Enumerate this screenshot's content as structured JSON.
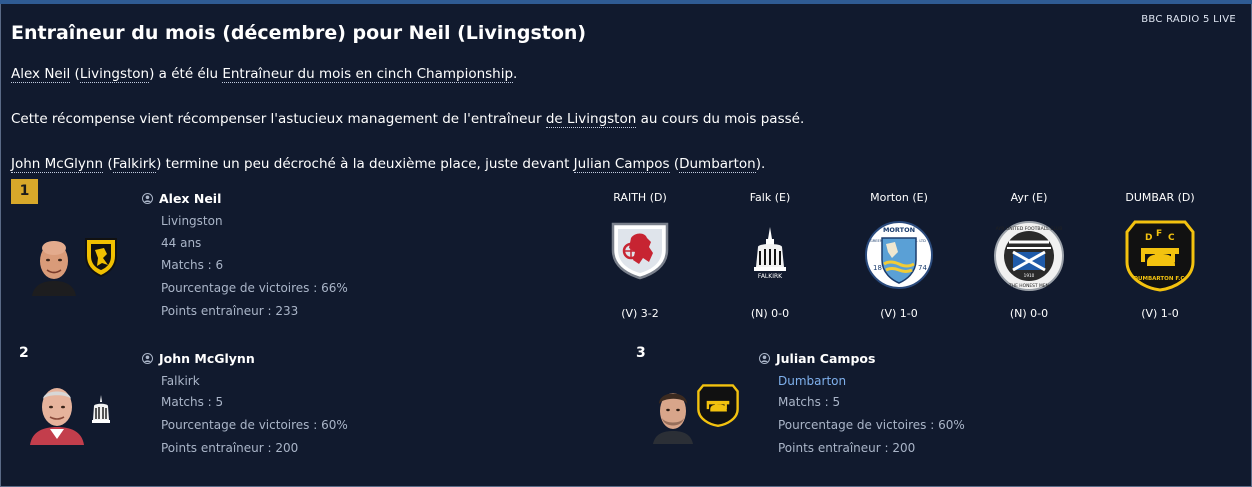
{
  "source": "BBC RADIO 5 LIVE",
  "headline": "Entraîneur du mois (décembre) pour Neil (Livingston)",
  "paragraph1": {
    "manager": "Alex Neil",
    "club": "Livingston",
    "mid": "a été élu",
    "award": "Entraîneur du mois en cinch Championship",
    "end": "."
  },
  "paragraph2": {
    "start": "Cette récompense vient récompenser l'astucieux management de l'entraîneur",
    "club": "de Livingston",
    "end": "au cours du mois passé."
  },
  "paragraph3": {
    "second": "John McGlynn",
    "second_club": "Falkirk",
    "mid": "termine un peu décroché à la deuxième place, juste devant",
    "third": "Julian Campos",
    "third_club": "Dumbarton",
    "end": ")."
  },
  "ranking": [
    {
      "rank": "1",
      "name": "Alex Neil",
      "club": "Livingston",
      "age": "44 ans",
      "matches": "Matchs : 6",
      "win_pct": "Pourcentage de victoires : 66%",
      "points": "Points entraîneur : 233"
    },
    {
      "rank": "2",
      "name": "John McGlynn",
      "club": "Falkirk",
      "matches": "Matchs : 5",
      "win_pct": "Pourcentage de victoires : 60%",
      "points": "Points entraîneur : 200"
    },
    {
      "rank": "3",
      "name": "Julian Campos",
      "club": "Dumbarton",
      "matches": "Matchs : 5",
      "win_pct": "Pourcentage de victoires : 60%",
      "points": "Points entraîneur : 200"
    }
  ],
  "results": [
    {
      "opponent": "RAITH (D)",
      "score": "(V) 3-2",
      "crest_icon": "raith-rovers-crest"
    },
    {
      "opponent": "Falk (E)",
      "score": "(N) 0-0",
      "crest_icon": "falkirk-crest"
    },
    {
      "opponent": "Morton (E)",
      "score": "(V) 1-0",
      "crest_icon": "morton-crest"
    },
    {
      "opponent": "Ayr (E)",
      "score": "(N) 0-0",
      "crest_icon": "ayr-united-crest"
    },
    {
      "opponent": "DUMBAR (D)",
      "score": "(V) 1-0",
      "crest_icon": "dumbarton-crest"
    }
  ],
  "crest_text": {
    "falkirk": "FALKIRK",
    "morton": "MORTON",
    "greenock": "GREENOCK",
    "fc": "F.C. LTD",
    "morton_year_a": "18",
    "morton_year_b": "74",
    "ayr_ring": "AYR UNITED FOOTBALL CLUB",
    "ayr_bottom": "THE HONEST MEN",
    "ayr_year": "1910",
    "dumbarton_letters": [
      "D",
      "F",
      "C"
    ],
    "dumbarton_bottom": "DUMBARTON F.C."
  },
  "colors": {
    "background": "#111a2e",
    "accent_bar": "#2f5b93",
    "rank1": "#d8a82a",
    "stat_text": "#aab5c8",
    "link_blue": "#7fb0ec"
  }
}
